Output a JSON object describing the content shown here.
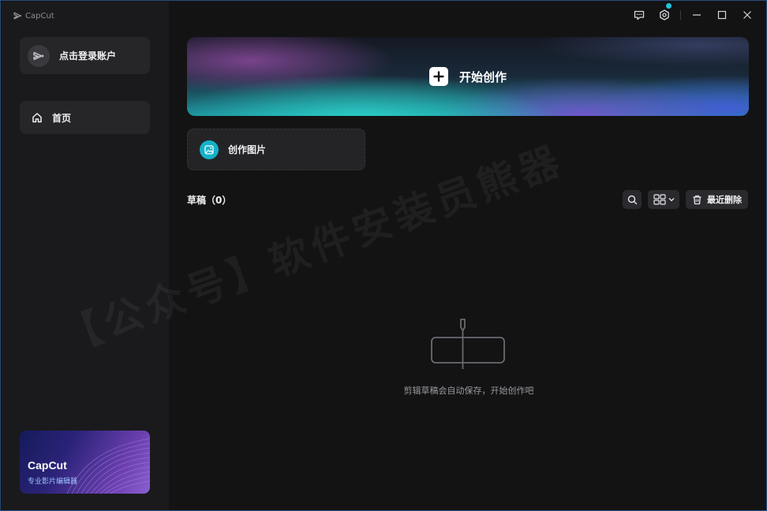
{
  "app": {
    "name": "CapCut"
  },
  "titlebar": {
    "icons": [
      "feedback-icon",
      "settings-icon",
      "minimize-icon",
      "maximize-icon",
      "close-icon"
    ]
  },
  "sidebar": {
    "login_label": "点击登录账户",
    "nav": [
      {
        "label": "首页",
        "icon": "home-icon"
      }
    ],
    "promo": {
      "title": "CapCut",
      "subtitle": "专业影片编辑器"
    }
  },
  "main": {
    "start_create_label": "开始创作",
    "create_image_label": "创作图片",
    "drafts": {
      "title": "草稿（0）",
      "recently_deleted_label": "最近删除",
      "empty_text": "剪辑草稿会自动保存，开始创作吧"
    },
    "watermark": "【公众号】软件安装员熊器"
  },
  "colors": {
    "accent": "#22c5d8",
    "create_image_icon_bg": "#15b1c9",
    "sidebar_bg": "#1a1a1c",
    "main_bg": "#131314",
    "card_bg": "#262629"
  }
}
